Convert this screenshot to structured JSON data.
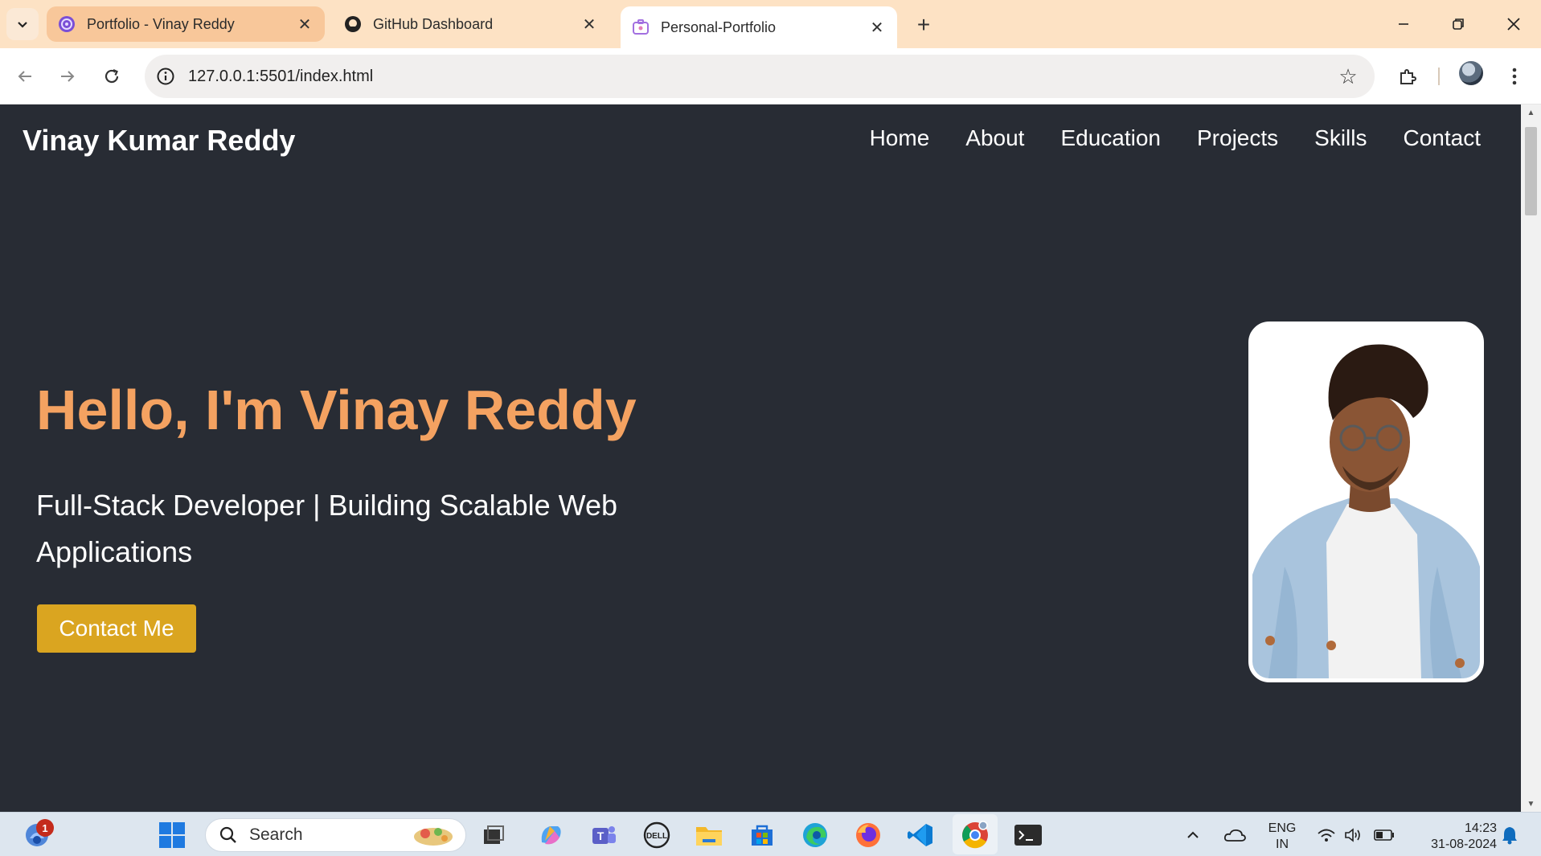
{
  "browser": {
    "tabs": [
      {
        "title": "Portfolio - Vinay Reddy",
        "favicon": "purple-globe-icon",
        "active": false
      },
      {
        "title": "GitHub Dashboard",
        "favicon": "github-icon",
        "active": false
      },
      {
        "title": "Personal-Portfolio",
        "favicon": "purple-portfolio-icon",
        "active": true
      }
    ],
    "url": "127.0.0.1:5501/index.html"
  },
  "site": {
    "brand": "Vinay Kumar Reddy",
    "nav": [
      "Home",
      "About",
      "Education",
      "Projects",
      "Skills",
      "Contact"
    ],
    "hero": {
      "title": "Hello, I'm Vinay Reddy",
      "subtitle": "Full-Stack Developer | Building Scalable Web Applications",
      "cta": "Contact Me"
    }
  },
  "taskbar": {
    "search_placeholder": "Search",
    "notification_count": "1",
    "language": {
      "line1": "ENG",
      "line2": "IN"
    },
    "time": "14:23",
    "date": "31-08-2024"
  },
  "colors": {
    "page_bg": "#282c34",
    "hero_title": "#f4a261",
    "cta_bg": "#daa520",
    "tab_strip": "#fde2c4"
  }
}
